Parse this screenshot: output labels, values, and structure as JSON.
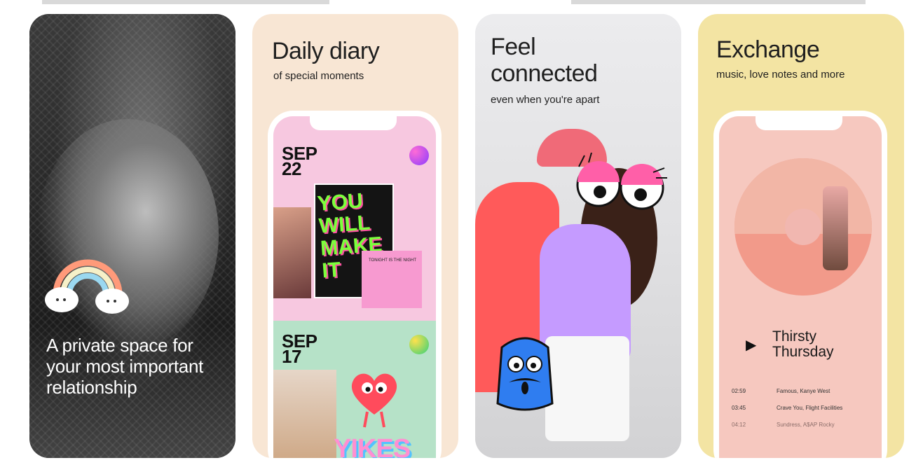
{
  "gallery": {
    "cards": [
      {
        "caption": "A private space for your most important relationship"
      },
      {
        "title": "Daily diary",
        "subtitle": "of special moments",
        "entries": [
          {
            "month": "SEP",
            "day": "22",
            "dot_color": "#8a3cff"
          },
          {
            "month": "SEP",
            "day": "17",
            "dot_color": "#33d17a"
          }
        ],
        "poster_text": "YOU WILL MAKE IT",
        "note_text": "TONIGHT IS THE NIGHT",
        "sticker_text": "YIKES"
      },
      {
        "title": "Feel connected",
        "subtitle": "even when you're apart"
      },
      {
        "title": "Exchange",
        "subtitle": "music, love notes and more",
        "now_playing": "Thirsty Thursday",
        "play_icon": "play-icon",
        "tracks": [
          {
            "time": "02:59",
            "name": "Famous, Kanye West"
          },
          {
            "time": "03:45",
            "name": "Crave You, Flight Facilities"
          },
          {
            "time": "04:12",
            "name": "Sundress, A$AP Rocky"
          }
        ]
      }
    ]
  }
}
